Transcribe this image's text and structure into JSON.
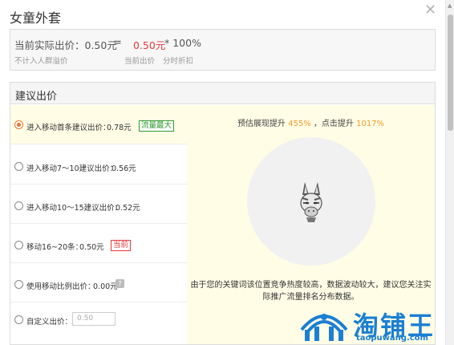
{
  "dialog": {
    "title": "女童外套",
    "close_icon": "close-icon"
  },
  "current": {
    "label": "当前实际出价：0.50元",
    "equals": "=",
    "current_price": "0.50元",
    "multiplier": "* 100%",
    "note_left": "不计入人群溢价",
    "note_mid": "当前出价",
    "note_right": "分时折扣"
  },
  "suggest": {
    "title": "建议出价",
    "options": [
      {
        "label": "进入移动首条建议出价：",
        "price": "0.78元",
        "tag": "流量最大",
        "selected": true
      },
      {
        "label": "进入移动7～10建议出价：",
        "price": "0.56元",
        "selected": false
      },
      {
        "label": "进入移动10～15建议出价：",
        "price": "0.52元",
        "selected": false
      },
      {
        "label": "移动16~20条：",
        "price": "0.50元",
        "tag": "当前",
        "selected": false
      },
      {
        "label": "使用移动比例出价：",
        "price": "0.00元",
        "icon": "help-icon",
        "selected": false
      },
      {
        "label": "自定义出价：",
        "input_value": "0.50",
        "selected": false
      }
    ],
    "estimate_prefix": "预估展现提升",
    "estimate_show_pct": "455%",
    "estimate_mid": "，点击提升",
    "estimate_click_pct": "1017%",
    "mascot_icon": "zebra-mascot-icon",
    "note_line1": "由于您的关键词该位置竞争热度较高，数据波动较大，建议您关注实",
    "note_line2": "际推广流量排名分布数据。"
  },
  "watermark": {
    "text": "淘铺王",
    "url": "taopuwang.com"
  },
  "colors": {
    "accent_red": "#e4393c",
    "accent_orange": "#f39b2a",
    "tag_green": "#2f9a2f",
    "highlight_bg": "#fffde6",
    "brand_blue": "#1b7fd3"
  }
}
